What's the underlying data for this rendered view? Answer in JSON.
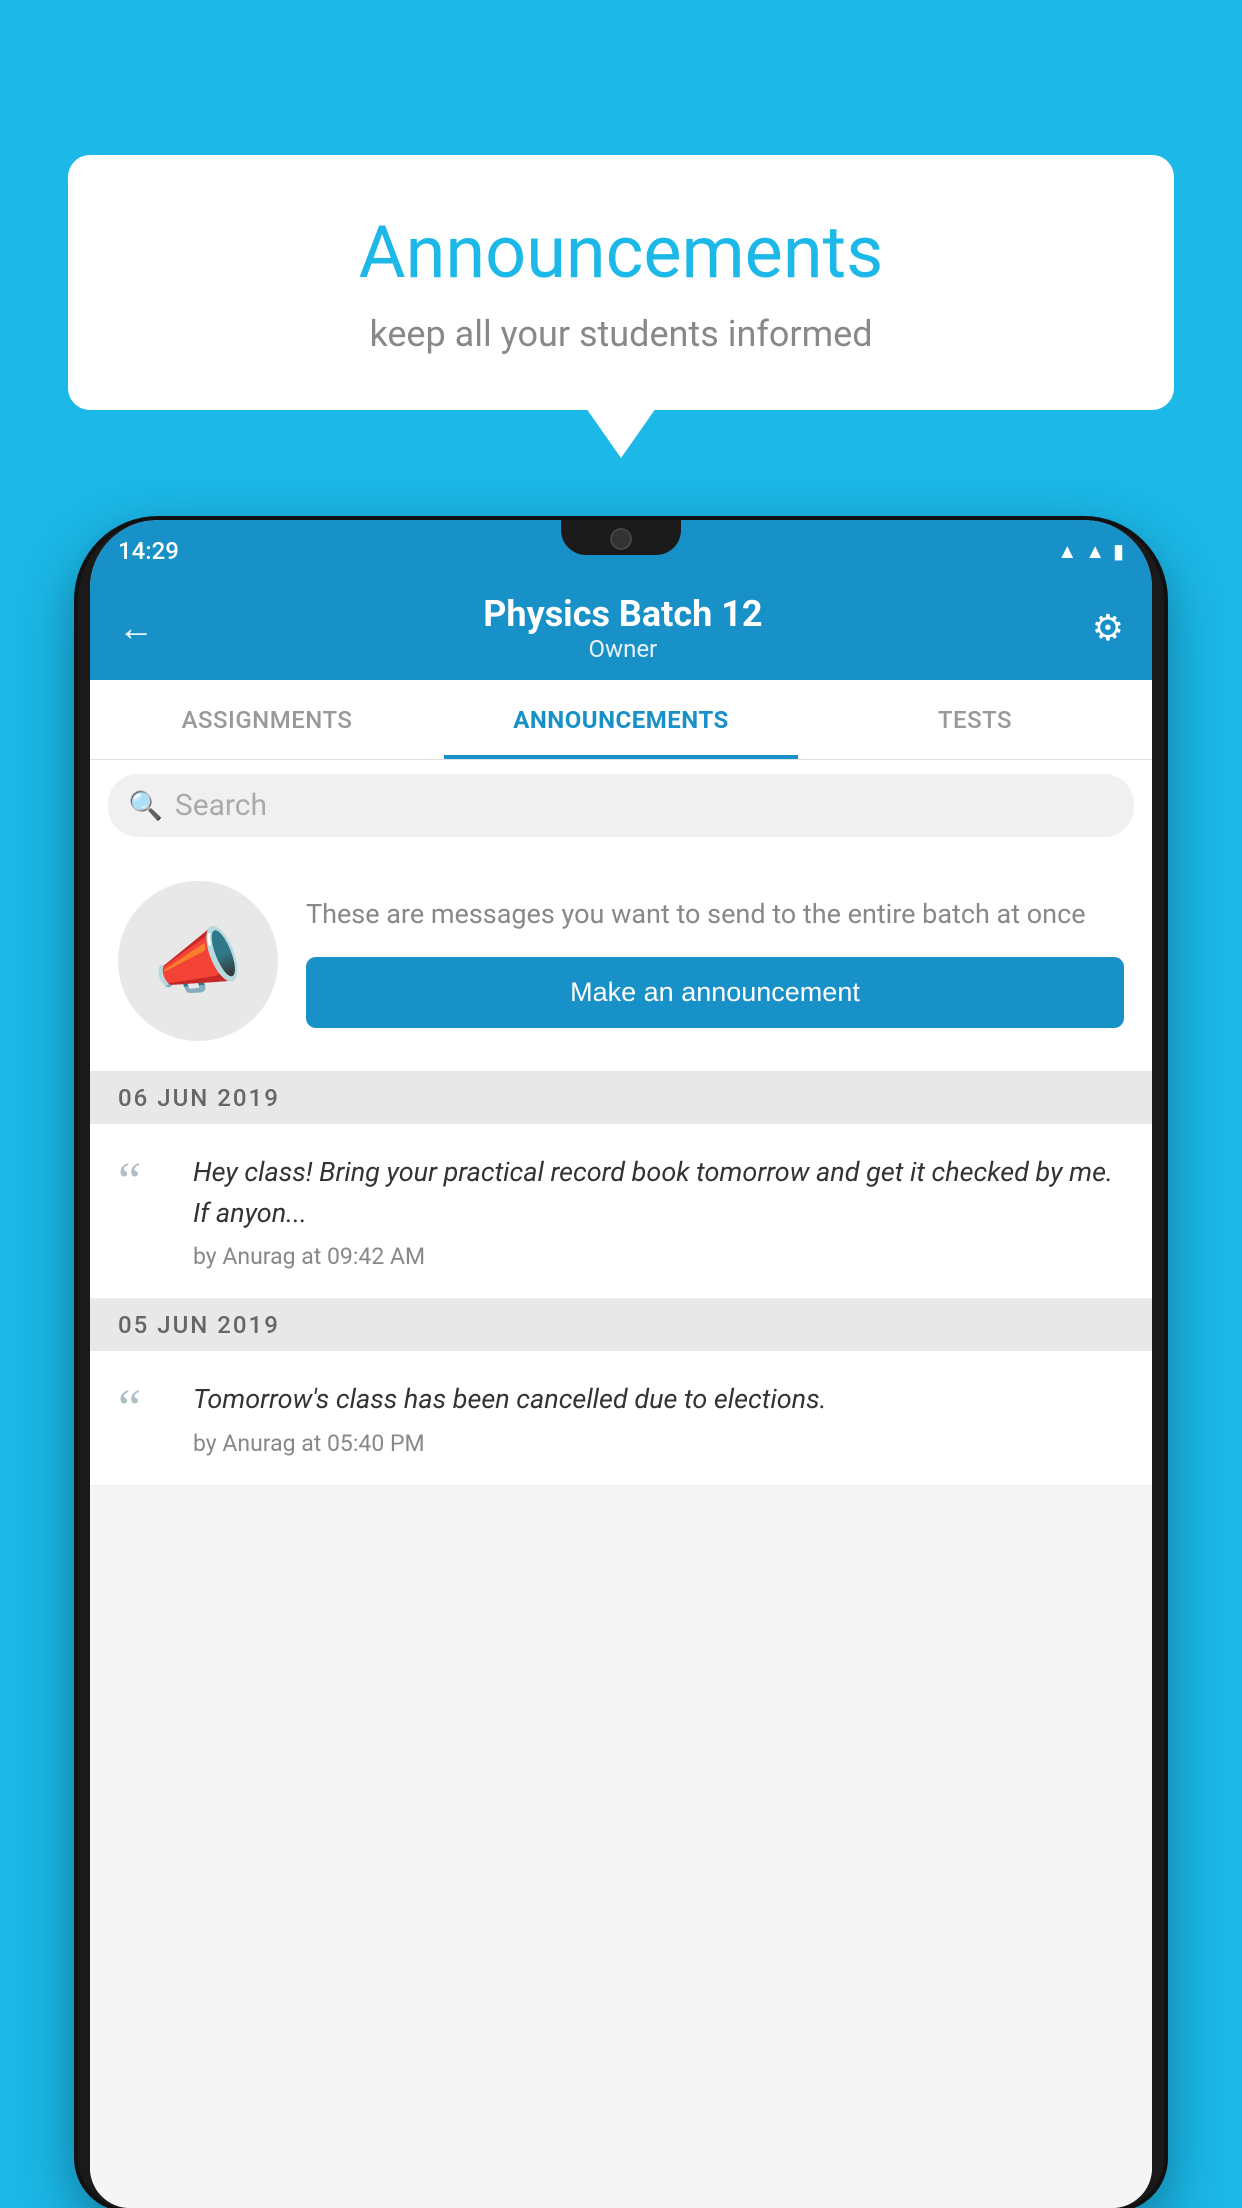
{
  "background_color": "#1bb8e8",
  "speech_bubble": {
    "title": "Announcements",
    "subtitle": "keep all your students informed"
  },
  "phone": {
    "status_bar": {
      "time": "14:29",
      "icons": [
        "wifi",
        "signal",
        "battery"
      ]
    },
    "header": {
      "back_label": "←",
      "title": "Physics Batch 12",
      "subtitle": "Owner",
      "settings_label": "⚙"
    },
    "tabs": [
      {
        "label": "ASSIGNMENTS",
        "active": false
      },
      {
        "label": "ANNOUNCEMENTS",
        "active": true
      },
      {
        "label": "TESTS",
        "active": false
      }
    ],
    "search": {
      "placeholder": "Search"
    },
    "empty_state": {
      "description": "These are messages you want to send to the entire batch at once",
      "cta_label": "Make an announcement"
    },
    "date_sections": [
      {
        "date": "06  JUN  2019",
        "announcements": [
          {
            "text": "Hey class! Bring your practical record book tomorrow and get it checked by me. If anyon...",
            "meta": "by Anurag at 09:42 AM"
          }
        ]
      },
      {
        "date": "05  JUN  2019",
        "announcements": [
          {
            "text": "Tomorrow's class has been cancelled due to elections.",
            "meta": "by Anurag at 05:40 PM"
          }
        ]
      }
    ]
  }
}
